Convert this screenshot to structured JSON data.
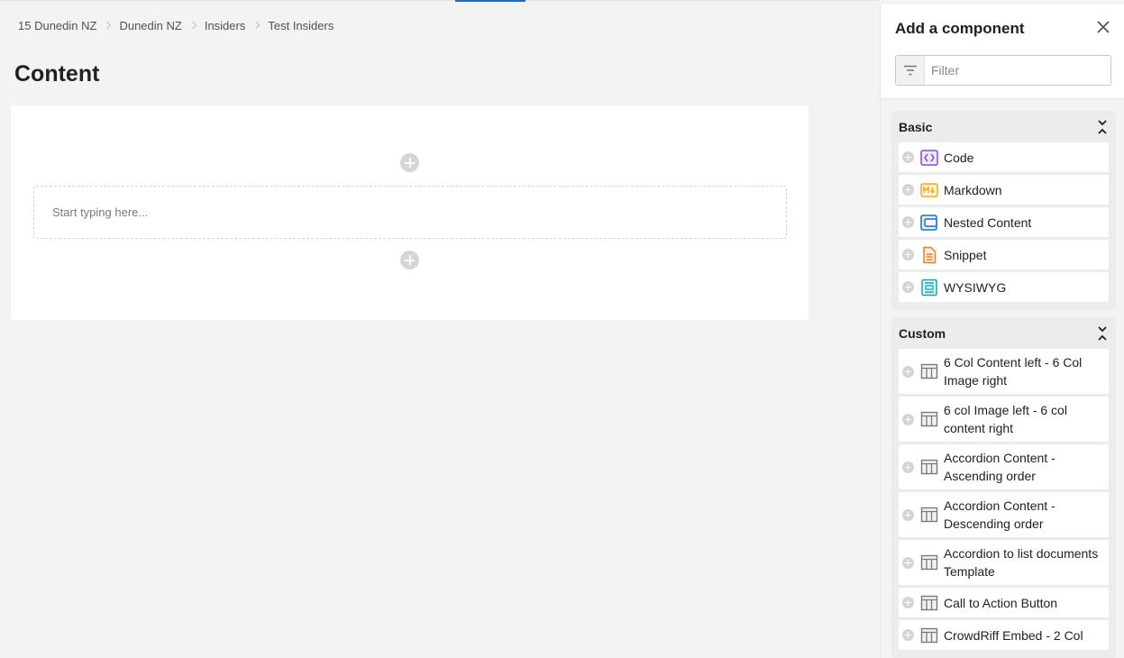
{
  "breadcrumb": [
    "15 Dunedin NZ",
    "Dunedin NZ",
    "Insiders",
    "Test Insiders"
  ],
  "page": {
    "title": "Content",
    "editor_placeholder": "Start typing here..."
  },
  "panel": {
    "title": "Add a component",
    "filter_placeholder": "Filter",
    "groups": [
      {
        "name": "Basic",
        "items": [
          {
            "label": "Code",
            "icon": "code-icon",
            "color": "#7b4fd6"
          },
          {
            "label": "Markdown",
            "icon": "markdown-icon",
            "color": "#f0a81c"
          },
          {
            "label": "Nested Content",
            "icon": "nested-content-icon",
            "color": "#1b6ec2"
          },
          {
            "label": "Snippet",
            "icon": "snippet-icon",
            "color": "#f07c1c"
          },
          {
            "label": "WYSIWYG",
            "icon": "wysiwyg-icon",
            "color": "#1aa3b8"
          }
        ]
      },
      {
        "name": "Custom",
        "items": [
          {
            "label": "6 Col Content left - 6 Col Image right",
            "icon": "layout-icon"
          },
          {
            "label": "6 col Image left - 6 col content right",
            "icon": "layout-icon"
          },
          {
            "label": "Accordion Content - Ascending order",
            "icon": "layout-icon"
          },
          {
            "label": "Accordion Content - Descending order",
            "icon": "layout-icon"
          },
          {
            "label": "Accordion to list documents Template",
            "icon": "layout-icon"
          },
          {
            "label": "Call to Action Button",
            "icon": "layout-icon"
          },
          {
            "label": "CrowdRiff Embed - 2 Col",
            "icon": "layout-icon"
          }
        ]
      }
    ]
  }
}
